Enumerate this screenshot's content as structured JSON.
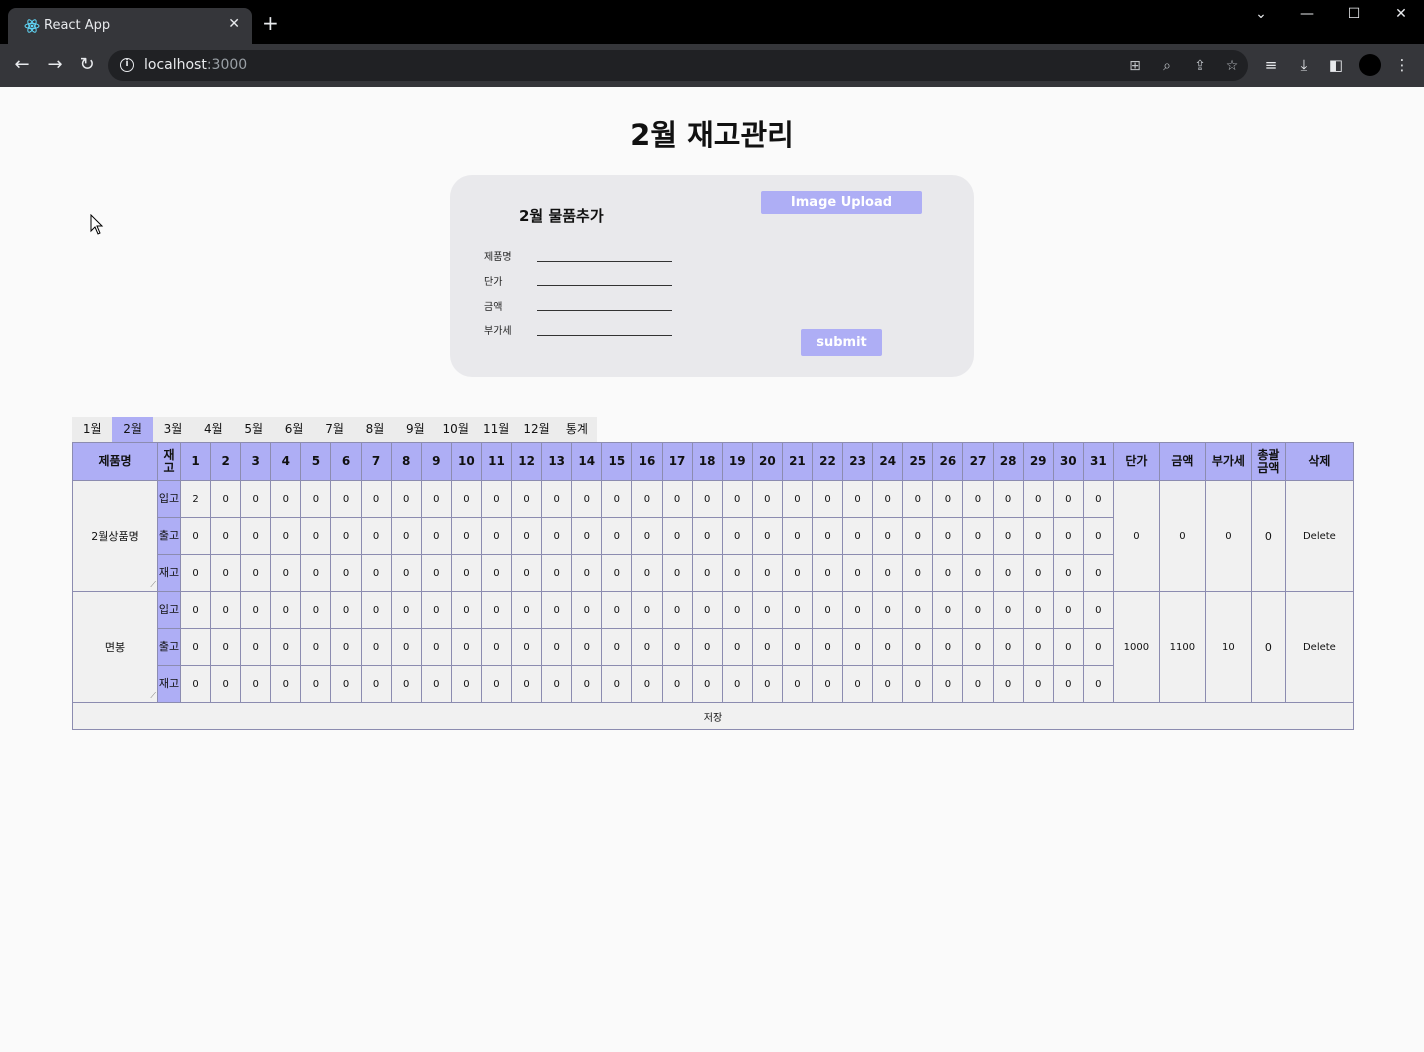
{
  "browser": {
    "tab_title": "React App",
    "url_host": "localhost",
    "url_port": ":3000",
    "tab_close": "✕",
    "new_tab": "+"
  },
  "page": {
    "title": "2월 재고관리"
  },
  "form": {
    "title": "2월 물품추가",
    "fields": [
      {
        "label": "제품명",
        "value": ""
      },
      {
        "label": "단가",
        "value": ""
      },
      {
        "label": "금액",
        "value": ""
      },
      {
        "label": "부가세",
        "value": ""
      }
    ],
    "image_upload_label": "Image Upload",
    "submit_label": "submit"
  },
  "months": {
    "active_index": 1,
    "tabs": [
      "1월",
      "2월",
      "3월",
      "4월",
      "5월",
      "6월",
      "7월",
      "8월",
      "9월",
      "10월",
      "11월",
      "12월",
      "통계"
    ]
  },
  "table": {
    "headers": {
      "product": "제품명",
      "type": "재고",
      "days": [
        "1",
        "2",
        "3",
        "4",
        "5",
        "6",
        "7",
        "8",
        "9",
        "10",
        "11",
        "12",
        "13",
        "14",
        "15",
        "16",
        "17",
        "18",
        "19",
        "20",
        "21",
        "22",
        "23",
        "24",
        "25",
        "26",
        "27",
        "28",
        "29",
        "30",
        "31"
      ],
      "unit_price": "단가",
      "amount": "금액",
      "vat": "부가세",
      "total": "총괄금액",
      "delete": "삭제"
    },
    "row_types": [
      "입고",
      "출고",
      "재고"
    ],
    "products": [
      {
        "name": "2월상품명",
        "rows": [
          [
            "2",
            "0",
            "0",
            "0",
            "0",
            "0",
            "0",
            "0",
            "0",
            "0",
            "0",
            "0",
            "0",
            "0",
            "0",
            "0",
            "0",
            "0",
            "0",
            "0",
            "0",
            "0",
            "0",
            "0",
            "0",
            "0",
            "0",
            "0",
            "0",
            "0",
            "0"
          ],
          [
            "0",
            "0",
            "0",
            "0",
            "0",
            "0",
            "0",
            "0",
            "0",
            "0",
            "0",
            "0",
            "0",
            "0",
            "0",
            "0",
            "0",
            "0",
            "0",
            "0",
            "0",
            "0",
            "0",
            "0",
            "0",
            "0",
            "0",
            "0",
            "0",
            "0",
            "0"
          ],
          [
            "0",
            "0",
            "0",
            "0",
            "0",
            "0",
            "0",
            "0",
            "0",
            "0",
            "0",
            "0",
            "0",
            "0",
            "0",
            "0",
            "0",
            "0",
            "0",
            "0",
            "0",
            "0",
            "0",
            "0",
            "0",
            "0",
            "0",
            "0",
            "0",
            "0",
            "0"
          ]
        ],
        "unit_price": "0",
        "amount": "0",
        "vat": "0",
        "total": "0",
        "delete_label": "Delete"
      },
      {
        "name": "면봉",
        "rows": [
          [
            "0",
            "0",
            "0",
            "0",
            "0",
            "0",
            "0",
            "0",
            "0",
            "0",
            "0",
            "0",
            "0",
            "0",
            "0",
            "0",
            "0",
            "0",
            "0",
            "0",
            "0",
            "0",
            "0",
            "0",
            "0",
            "0",
            "0",
            "0",
            "0",
            "0",
            "0"
          ],
          [
            "0",
            "0",
            "0",
            "0",
            "0",
            "0",
            "0",
            "0",
            "0",
            "0",
            "0",
            "0",
            "0",
            "0",
            "0",
            "0",
            "0",
            "0",
            "0",
            "0",
            "0",
            "0",
            "0",
            "0",
            "0",
            "0",
            "0",
            "0",
            "0",
            "0",
            "0"
          ],
          [
            "0",
            "0",
            "0",
            "0",
            "0",
            "0",
            "0",
            "0",
            "0",
            "0",
            "0",
            "0",
            "0",
            "0",
            "0",
            "0",
            "0",
            "0",
            "0",
            "0",
            "0",
            "0",
            "0",
            "0",
            "0",
            "0",
            "0",
            "0",
            "0",
            "0",
            "0"
          ]
        ],
        "unit_price": "1000",
        "amount": "1100",
        "vat": "10",
        "total": "0",
        "delete_label": "Delete"
      }
    ],
    "save_label": "저장"
  },
  "colors": {
    "accent": "#aeaef5",
    "form_bg": "#e9e9ec",
    "page_bg": "#fafafa"
  }
}
